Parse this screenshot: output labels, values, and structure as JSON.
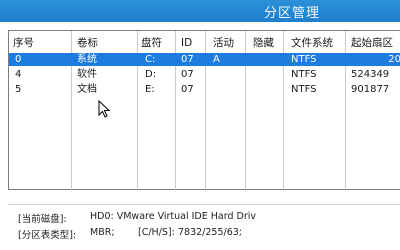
{
  "window": {
    "title": "分区管理"
  },
  "table": {
    "columns": [
      "序号",
      "卷标",
      "盘符",
      "ID",
      "活动",
      "隐藏",
      "文件系统",
      "起始扇区"
    ],
    "rows": [
      {
        "index": "0",
        "volume": "系统",
        "drive": "C:",
        "id": "07",
        "active": "A",
        "hidden": "",
        "fs": "NTFS",
        "start": "20",
        "selected": true
      },
      {
        "index": "4",
        "volume": "软件",
        "drive": "D:",
        "id": "07",
        "active": "",
        "hidden": "",
        "fs": "NTFS",
        "start": "524349",
        "selected": false
      },
      {
        "index": "5",
        "volume": "文档",
        "drive": "E:",
        "id": "07",
        "active": "",
        "hidden": "",
        "fs": "NTFS",
        "start": "901877",
        "selected": false
      }
    ]
  },
  "info": {
    "disk_label": "[当前磁盘]:",
    "disk_value": "HD0: VMware Virtual IDE Hard Driv",
    "type_label": "[分区表类型]:",
    "type_value": "MBR;",
    "chs_label": "[C/H/S]:",
    "chs_value": "7832/255/63;"
  },
  "colors": {
    "titlebar": "#2b91d9",
    "selection": "#1e7be0"
  },
  "icons": {
    "cursor": "arrow-cursor-icon"
  }
}
